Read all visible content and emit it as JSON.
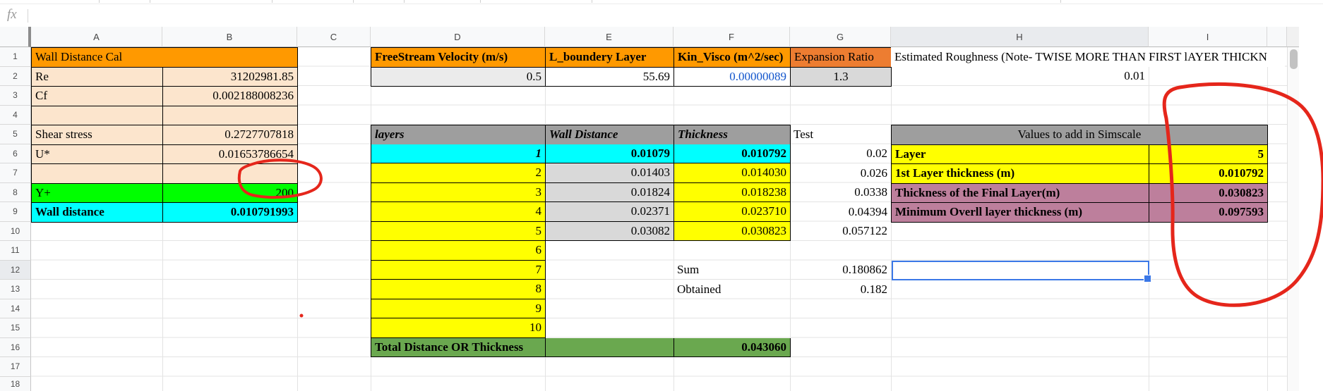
{
  "formula_bar": {
    "fx_label": "fx",
    "input_value": ""
  },
  "column_headers": [
    "A",
    "B",
    "C",
    "D",
    "E",
    "F",
    "G",
    "H",
    "I"
  ],
  "row_headers": [
    "1",
    "2",
    "3",
    "4",
    "5",
    "6",
    "7",
    "8",
    "9",
    "10",
    "11",
    "12",
    "13",
    "14",
    "15",
    "16",
    "17",
    "18"
  ],
  "tables": {
    "wall_distance_cal": {
      "title": "Wall Distance Cal",
      "rows": [
        {
          "label": "Re",
          "value": "31202981.85"
        },
        {
          "label": "Cf",
          "value": "0.002188008236"
        },
        {
          "label": "",
          "value": ""
        },
        {
          "label": "Shear stress",
          "value": "0.2727707818"
        },
        {
          "label": "U*",
          "value": "0.01653786654"
        },
        {
          "label": "",
          "value": ""
        },
        {
          "label": "Y+",
          "value": "200"
        },
        {
          "label": "Wall distance",
          "value": "0.010791993"
        }
      ]
    },
    "freestream": {
      "headers": [
        "FreeStream Velocity (m/s)",
        "L_boundery Layer",
        "Kin_Visco (m^2/sec)",
        "Expansion Ratio"
      ],
      "values": [
        "0.5",
        "55.69",
        "0.00000089",
        "1.3"
      ]
    },
    "layers": {
      "headers": [
        "layers",
        "Wall Distance",
        "Thickness"
      ],
      "test_header": "Test",
      "rows": [
        {
          "n": "1",
          "wd": "0.01079",
          "th": "0.010792",
          "test": "0.02"
        },
        {
          "n": "2",
          "wd": "0.01403",
          "th": "0.014030",
          "test": "0.026"
        },
        {
          "n": "3",
          "wd": "0.01824",
          "th": "0.018238",
          "test": "0.0338"
        },
        {
          "n": "4",
          "wd": "0.02371",
          "th": "0.023710",
          "test": "0.04394"
        },
        {
          "n": "5",
          "wd": "0.03082",
          "th": "0.030823",
          "test": "0.057122"
        },
        {
          "n": "6"
        },
        {
          "n": "7"
        },
        {
          "n": "8"
        },
        {
          "n": "9"
        },
        {
          "n": "10"
        }
      ],
      "sum_label": "Sum",
      "sum_value": "0.180862",
      "obtained_label": "Obtained",
      "obtained_value": "0.182",
      "total_label": "Total Distance OR Thickness",
      "total_value": "0.043060"
    },
    "simscale": {
      "title": "Values to add in Simscale",
      "rows": [
        {
          "label": "Layer",
          "value": "5"
        },
        {
          "label": "1st Layer thickness (m)",
          "value": "0.010792"
        },
        {
          "label": "Thickness of the Final Layer(m)",
          "value": "0.030823"
        },
        {
          "label": "Minimum Overll layer thickness (m)",
          "value": "0.097593"
        }
      ]
    },
    "roughness": {
      "note": "Estimated Roughness (Note- TWISE MORE THAN FIRST lAYER THICKN",
      "value": "0.01"
    }
  },
  "colors": {
    "orange": "#ff9900",
    "orange_dark": "#ed7d31",
    "cream": "#fce5cd",
    "yellow": "#ffff00",
    "cyan": "#00ffff",
    "bright_green": "#00ff00",
    "total_green": "#6aa84f",
    "header_gray": "#9e9e9e",
    "cell_gray": "#d9d9d9",
    "mauve": "#bd7f9c",
    "annotation_red": "#e5261b",
    "selection_blue": "#3b78e7",
    "link_blue": "#1155cc"
  }
}
